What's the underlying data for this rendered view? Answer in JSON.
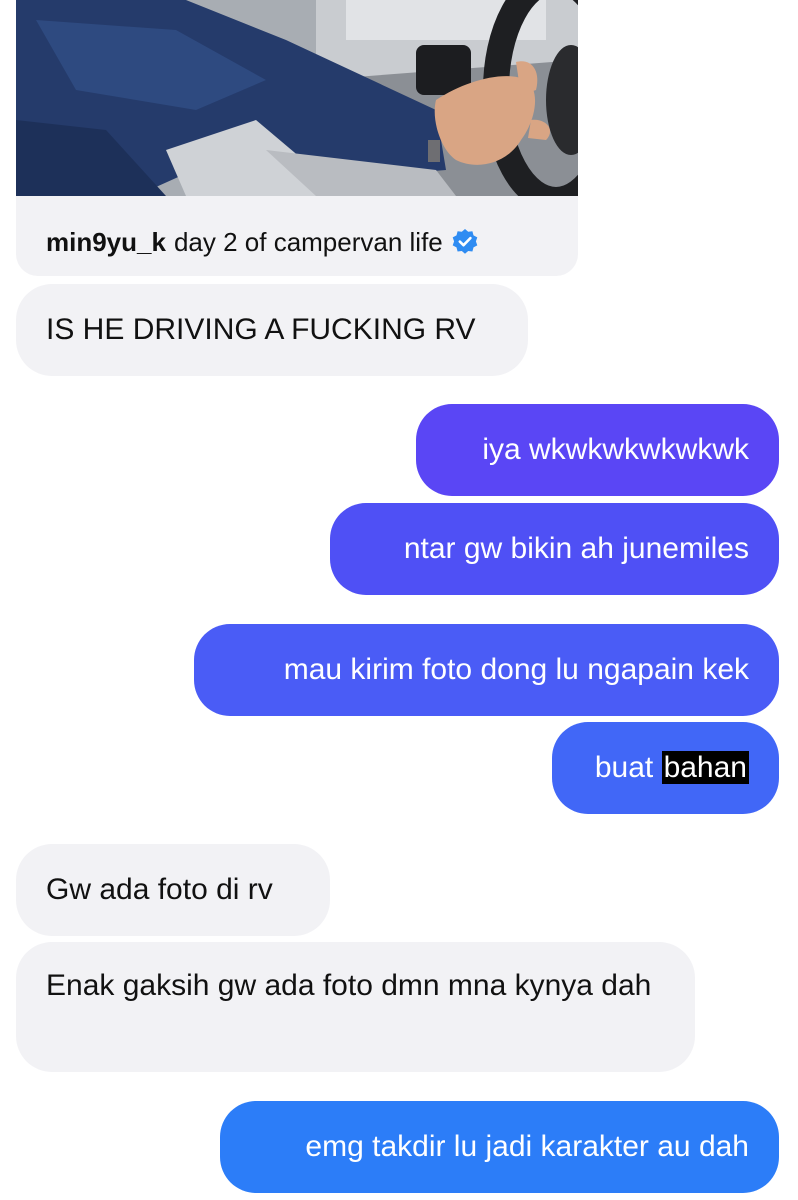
{
  "shared_post": {
    "username": "min9yu_k",
    "caption": "day 2 of campervan life",
    "verified_icon": "verified-badge-icon",
    "verified_color": "#2f8cf2"
  },
  "messages": [
    {
      "direction": "incoming",
      "text": "IS HE DRIVING A FUCKING RV"
    },
    {
      "direction": "outgoing",
      "text": "iya wkwkwkwkwkwk",
      "color": "#5a46f5"
    },
    {
      "direction": "outgoing",
      "text": "ntar gw bikin ah junemiles",
      "color": "#4f50f5"
    },
    {
      "direction": "outgoing",
      "text": "mau kirim foto dong lu ngapain kek",
      "color": "#4a5cf6"
    },
    {
      "direction": "outgoing",
      "text_before": "buat ",
      "text_selected": "bahan",
      "color": "#4167f7"
    },
    {
      "direction": "incoming",
      "text": "Gw ada foto di rv"
    },
    {
      "direction": "incoming",
      "text": "Enak gaksih gw ada foto dmn mna kynya dah"
    },
    {
      "direction": "outgoing",
      "text": "emg takdir lu jadi karakter au dah",
      "color": "#2c7df8"
    }
  ]
}
